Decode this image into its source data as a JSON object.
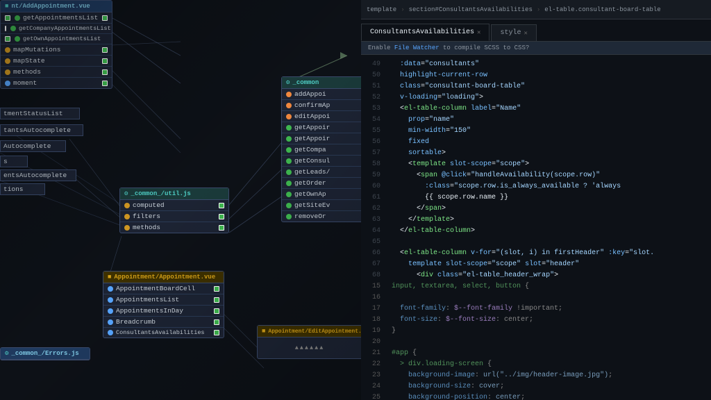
{
  "diagram": {
    "nodes": {
      "addAppointment": {
        "header": "nt/AddAppointment.vue",
        "rows": [
          {
            "dot": "green",
            "label": "getAppointmentsList"
          },
          {
            "dot": "green",
            "label": "getCompanyAppointmentsList"
          },
          {
            "dot": "green",
            "label": "getOwnAppointmentsList"
          },
          {
            "dot": "yellow",
            "label": "mapMutations"
          },
          {
            "dot": "yellow",
            "label": "mapState"
          },
          {
            "dot": "yellow",
            "label": "methods"
          },
          {
            "dot": "blue",
            "label": "moment"
          }
        ]
      },
      "util": {
        "header": "_common_/util.js",
        "rows": [
          {
            "dot": "yellow",
            "label": "computed"
          },
          {
            "dot": "yellow",
            "label": "filters"
          },
          {
            "dot": "yellow",
            "label": "methods"
          }
        ]
      },
      "commonMid": {
        "header": "_common",
        "rows": [
          {
            "dot": "orange",
            "label": "addAppoi"
          },
          {
            "dot": "orange",
            "label": "confirmAp"
          },
          {
            "dot": "orange",
            "label": "editAppoi"
          },
          {
            "dot": "green",
            "label": "getAppoir"
          },
          {
            "dot": "green",
            "label": "getAppoir"
          },
          {
            "dot": "green",
            "label": "getCompa"
          },
          {
            "dot": "green",
            "label": "getConsul"
          },
          {
            "dot": "green",
            "label": "getLeads/"
          },
          {
            "dot": "green",
            "label": "getOrder"
          },
          {
            "dot": "green",
            "label": "getOwnAp"
          },
          {
            "dot": "green",
            "label": "getSiteEv"
          },
          {
            "dot": "green",
            "label": "removeOr"
          }
        ]
      },
      "appointment": {
        "header": "Appointment/Appointment.vue",
        "rows": [
          {
            "dot": "blue",
            "label": "AppointmentBoardCell"
          },
          {
            "dot": "blue",
            "label": "AppointmentsList"
          },
          {
            "dot": "blue",
            "label": "AppointmentsInDay"
          },
          {
            "dot": "blue",
            "label": "Breadcrumb"
          },
          {
            "dot": "blue",
            "label": "ConsultantsAvailabilities"
          }
        ]
      },
      "errors": {
        "header": "_common_/Errors.js"
      },
      "editAppointment": {
        "header": "Appointment/EditAppointment.vue"
      }
    }
  },
  "editor": {
    "breadcrumb": {
      "parts": [
        "template",
        "section#ConsultantsAvailabilities",
        "el-table.consultant-board-table"
      ]
    },
    "tabs": [
      {
        "label": "ConsultantsAvailabilities",
        "active": true
      },
      {
        "label": "style",
        "active": false
      }
    ],
    "scss_bar": "Enable File Watcher to compile SCSS to CSS?",
    "scss_link": "File Watcher",
    "lines": [
      {
        "num": 49,
        "content": "  :data=\"consultants\"",
        "highlight": false,
        "tokens": [
          {
            "cls": "c-attr",
            "text": "  :data"
          },
          {
            "cls": "c-punct",
            "text": "="
          },
          {
            "cls": "c-str",
            "text": "\"consultants\""
          }
        ]
      },
      {
        "num": 50,
        "content": "  highlight-current-row",
        "highlight": false,
        "tokens": [
          {
            "cls": "c-attr",
            "text": "  highlight-current-row"
          }
        ]
      },
      {
        "num": 51,
        "content": "  class=\"consultant-board-table\"",
        "highlight": false,
        "tokens": [
          {
            "cls": "c-attr",
            "text": "  class"
          },
          {
            "cls": "c-punct",
            "text": "="
          },
          {
            "cls": "c-str",
            "text": "\"consultant-board-table\""
          }
        ]
      },
      {
        "num": 52,
        "content": "  v-loading=\"loading\">",
        "highlight": false,
        "tokens": [
          {
            "cls": "c-attr",
            "text": "  v-loading"
          },
          {
            "cls": "c-punct",
            "text": "="
          },
          {
            "cls": "c-str",
            "text": "\"loading\""
          },
          {
            "cls": "c-punct",
            "text": ">"
          }
        ]
      },
      {
        "num": 53,
        "content": "  <el-table-column label=\"Name\"",
        "highlight": false,
        "tokens": [
          {
            "cls": "c-punct",
            "text": "  <"
          },
          {
            "cls": "c-tag",
            "text": "el-table-column"
          },
          {
            "cls": "c-attr",
            "text": " label"
          },
          {
            "cls": "c-punct",
            "text": "="
          },
          {
            "cls": "c-str",
            "text": "\"Name\""
          }
        ]
      },
      {
        "num": 54,
        "content": "    prop=\"name\"",
        "highlight": false,
        "tokens": [
          {
            "cls": "c-attr",
            "text": "    prop"
          },
          {
            "cls": "c-punct",
            "text": "="
          },
          {
            "cls": "c-str",
            "text": "\"name\""
          }
        ]
      },
      {
        "num": 55,
        "content": "    min-width=\"150\"",
        "highlight": false,
        "tokens": [
          {
            "cls": "c-attr",
            "text": "    min-width"
          },
          {
            "cls": "c-punct",
            "text": "="
          },
          {
            "cls": "c-str",
            "text": "\"150\""
          }
        ]
      },
      {
        "num": 56,
        "content": "    fixed",
        "highlight": false,
        "tokens": [
          {
            "cls": "c-attr",
            "text": "    fixed"
          }
        ]
      },
      {
        "num": 57,
        "content": "    sortable>",
        "highlight": false,
        "tokens": [
          {
            "cls": "c-attr",
            "text": "    sortable"
          },
          {
            "cls": "c-punct",
            "text": ">"
          }
        ]
      },
      {
        "num": 58,
        "content": "    <template slot-scope=\"scope\">",
        "highlight": false,
        "tokens": [
          {
            "cls": "c-punct",
            "text": "    <"
          },
          {
            "cls": "c-tag",
            "text": "template"
          },
          {
            "cls": "c-attr",
            "text": " slot-scope"
          },
          {
            "cls": "c-punct",
            "text": "="
          },
          {
            "cls": "c-str",
            "text": "\"scope\""
          },
          {
            "cls": "c-punct",
            "text": ">"
          }
        ]
      },
      {
        "num": 59,
        "content": "      <span @click=\"handleAvailability(scope.row)\"",
        "highlight": false,
        "tokens": [
          {
            "cls": "c-punct",
            "text": "      <"
          },
          {
            "cls": "c-tag",
            "text": "span"
          },
          {
            "cls": "c-attr",
            "text": " @click"
          },
          {
            "cls": "c-punct",
            "text": "="
          },
          {
            "cls": "c-str",
            "text": "\"handleAvailability(scope.row)\""
          }
        ]
      },
      {
        "num": 60,
        "content": "        :class=\"scope.row.is_always_available ? 'always",
        "highlight": false,
        "tokens": [
          {
            "cls": "c-attr",
            "text": "        :class"
          },
          {
            "cls": "c-punct",
            "text": "="
          },
          {
            "cls": "c-str",
            "text": "\"scope.row.is_always_available ? 'always"
          }
        ]
      },
      {
        "num": 61,
        "content": "        {{ scope.row.name }}",
        "highlight": false,
        "tokens": [
          {
            "cls": "c-mustache",
            "text": "        {{ scope.row.name }}"
          }
        ]
      },
      {
        "num": 62,
        "content": "      </span>",
        "highlight": false,
        "tokens": [
          {
            "cls": "c-punct",
            "text": "      </"
          },
          {
            "cls": "c-tag",
            "text": "span"
          },
          {
            "cls": "c-punct",
            "text": ">"
          }
        ]
      },
      {
        "num": 63,
        "content": "    </template>",
        "highlight": false,
        "tokens": [
          {
            "cls": "c-punct",
            "text": "    </"
          },
          {
            "cls": "c-tag",
            "text": "template"
          },
          {
            "cls": "c-punct",
            "text": ">"
          }
        ]
      },
      {
        "num": 64,
        "content": "  </el-table-column>",
        "highlight": false,
        "tokens": [
          {
            "cls": "c-punct",
            "text": "  </"
          },
          {
            "cls": "c-tag",
            "text": "el-table-column"
          },
          {
            "cls": "c-punct",
            "text": ">"
          }
        ]
      },
      {
        "num": 65,
        "content": "",
        "highlight": false,
        "tokens": []
      },
      {
        "num": 66,
        "content": "  <el-table-column v-for=\"(slot, i) in firstHeader\" :key=\"slot.",
        "highlight": false,
        "tokens": [
          {
            "cls": "c-punct",
            "text": "  <"
          },
          {
            "cls": "c-tag",
            "text": "el-table-column"
          },
          {
            "cls": "c-attr",
            "text": " v-for"
          },
          {
            "cls": "c-punct",
            "text": "="
          },
          {
            "cls": "c-str",
            "text": "\"(slot, i) in firstHeader\""
          },
          {
            "cls": "c-attr",
            "text": " :key"
          },
          {
            "cls": "c-punct",
            "text": "="
          },
          {
            "cls": "c-str",
            "text": "\"slot."
          }
        ]
      },
      {
        "num": 67,
        "content": "    template slot-scope=\"scope\" slot=\"header\"",
        "highlight": false,
        "tokens": [
          {
            "cls": "c-attr",
            "text": "    template slot-scope"
          },
          {
            "cls": "c-punct",
            "text": "="
          },
          {
            "cls": "c-str",
            "text": "\"scope\""
          },
          {
            "cls": "c-attr",
            "text": " slot"
          },
          {
            "cls": "c-punct",
            "text": "="
          },
          {
            "cls": "c-str",
            "text": "\"header\""
          }
        ]
      },
      {
        "num": 68,
        "content": "      <div class=\"el-table_header_wrap\">",
        "highlight": false,
        "tokens": [
          {
            "cls": "c-punct",
            "text": "      <"
          },
          {
            "cls": "c-tag",
            "text": "div"
          },
          {
            "cls": "c-attr",
            "text": " class"
          },
          {
            "cls": "c-punct",
            "text": "="
          },
          {
            "cls": "c-str",
            "text": "\"el-table_header_wrap\""
          },
          {
            "cls": "c-punct",
            "text": ">"
          }
        ]
      },
      {
        "num": 15,
        "content": "input, textarea, select, button {",
        "highlight": false,
        "tokens": [
          {
            "cls": "c-css-sel",
            "text": "input, textarea, select, button"
          },
          {
            "cls": "c-punct",
            "text": " {"
          }
        ]
      },
      {
        "num": 17,
        "content": "  font-family: $--font-family !important;",
        "highlight": false,
        "tokens": [
          {
            "cls": "c-css-prop",
            "text": "  font-family"
          },
          {
            "cls": "c-punct",
            "text": ": "
          },
          {
            "cls": "c-css-var",
            "text": "$--font-family"
          },
          {
            "cls": "c-plain",
            "text": " !important;"
          }
        ]
      },
      {
        "num": 18,
        "content": "  font-size: $--font-size: center;",
        "highlight": false,
        "tokens": [
          {
            "cls": "c-css-prop",
            "text": "  font-size"
          },
          {
            "cls": "c-punct",
            "text": ": "
          },
          {
            "cls": "c-css-var",
            "text": "$--font-size"
          },
          {
            "cls": "c-plain",
            "text": ": center;"
          }
        ]
      },
      {
        "num": 19,
        "content": "}",
        "highlight": false,
        "tokens": [
          {
            "cls": "c-punct",
            "text": "}"
          }
        ]
      },
      {
        "num": 20,
        "content": "",
        "highlight": false,
        "tokens": []
      },
      {
        "num": 21,
        "content": "#app {",
        "highlight": false,
        "tokens": [
          {
            "cls": "c-css-sel",
            "text": "#app"
          },
          {
            "cls": "c-punct",
            "text": " {"
          }
        ]
      },
      {
        "num": 22,
        "content": "  > div.loading-screen {",
        "highlight": false,
        "tokens": [
          {
            "cls": "c-css-sel",
            "text": "  > div.loading-screen"
          },
          {
            "cls": "c-punct",
            "text": " {"
          }
        ]
      },
      {
        "num": 23,
        "content": "    background-image: url(\"../img/header-image.jpg\");",
        "highlight": false,
        "tokens": [
          {
            "cls": "c-css-prop",
            "text": "    background-image"
          },
          {
            "cls": "c-punct",
            "text": ": "
          },
          {
            "cls": "c-css-val",
            "text": "url(\"../img/header-image.jpg\")"
          },
          {
            "cls": "c-punct",
            "text": ";"
          }
        ]
      },
      {
        "num": 24,
        "content": "    background-size: cover;",
        "highlight": false,
        "tokens": [
          {
            "cls": "c-css-prop",
            "text": "    background-size"
          },
          {
            "cls": "c-punct",
            "text": ": "
          },
          {
            "cls": "c-css-val",
            "text": "cover"
          },
          {
            "cls": "c-punct",
            "text": ";"
          }
        ]
      },
      {
        "num": 25,
        "content": "    background-position: center;",
        "highlight": false,
        "tokens": [
          {
            "cls": "c-css-prop",
            "text": "    background-position"
          },
          {
            "cls": "c-punct",
            "text": ": "
          },
          {
            "cls": "c-css-val",
            "text": "center"
          },
          {
            "cls": "c-punct",
            "text": ";"
          }
        ]
      }
    ]
  }
}
